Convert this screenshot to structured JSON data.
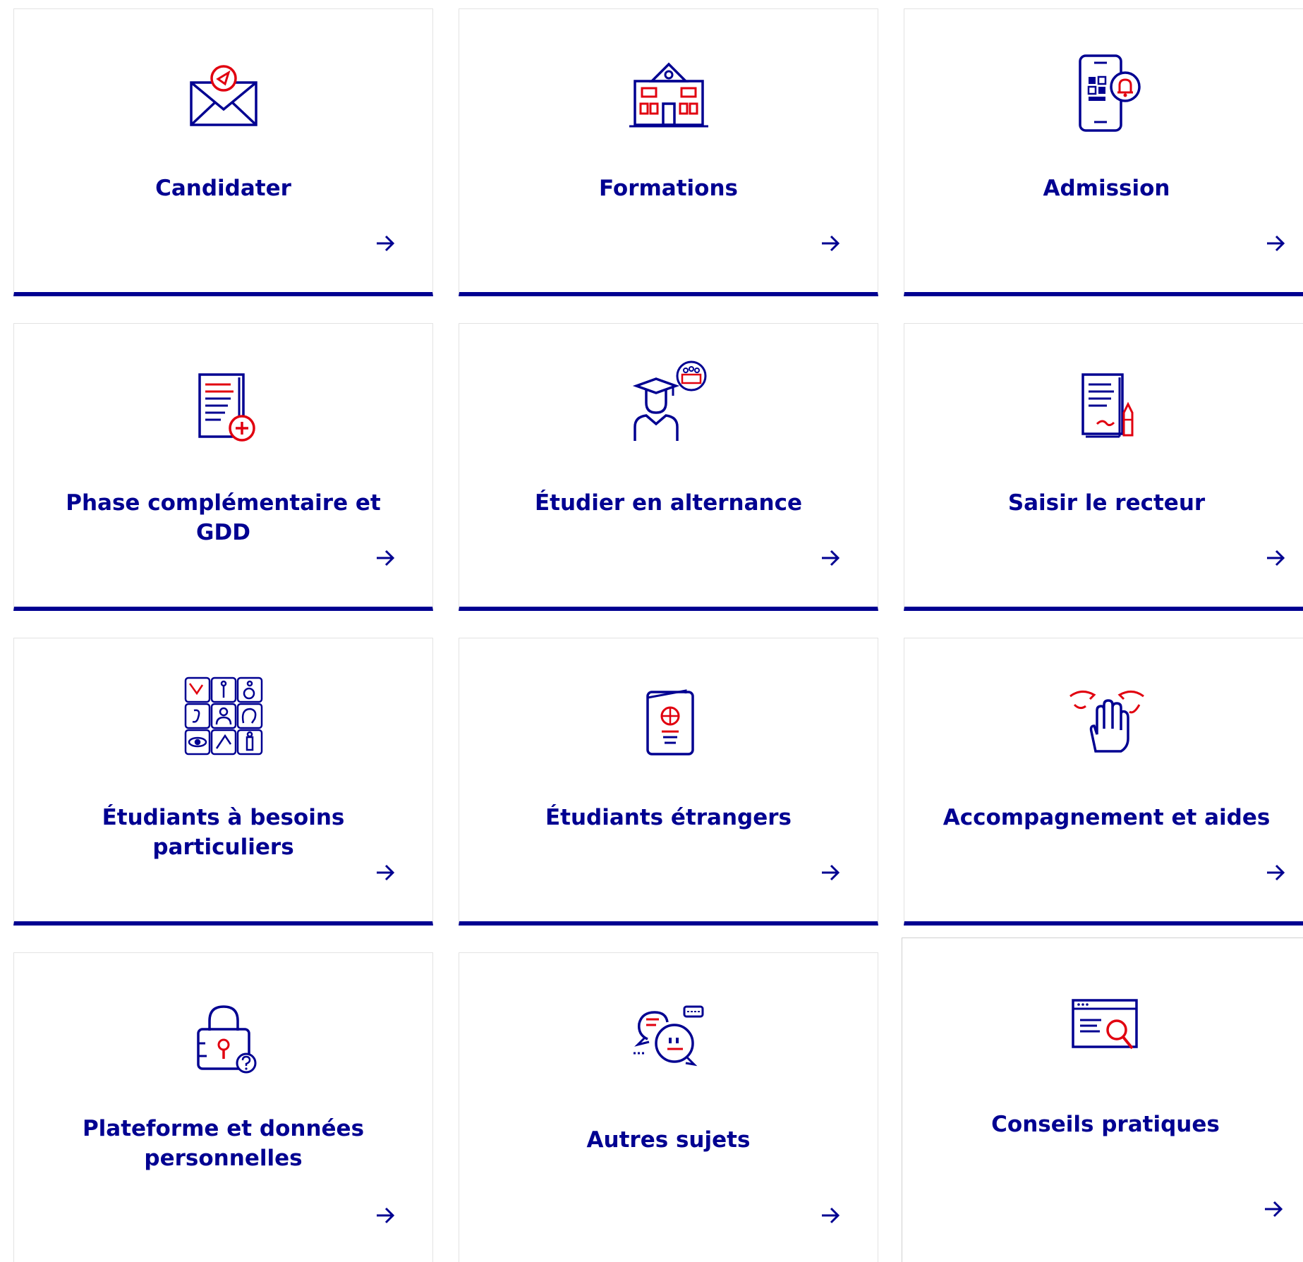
{
  "colors": {
    "primary": "#000091",
    "accent": "#e1000f",
    "border": "#e3e3e3",
    "background": "#ffffff"
  },
  "tiles": [
    {
      "title": "Candidater",
      "icon": "envelope-icon"
    },
    {
      "title": "Formations",
      "icon": "school-building-icon"
    },
    {
      "title": "Admission",
      "icon": "phone-notification-icon"
    },
    {
      "title": "Phase complémentaire et GDD",
      "icon": "document-add-icon"
    },
    {
      "title": "Étudier en alternance",
      "icon": "graduate-icon"
    },
    {
      "title": "Saisir le recteur",
      "icon": "document-pen-icon"
    },
    {
      "title": "Étudiants à besoins particuliers",
      "icon": "accessibility-grid-icon"
    },
    {
      "title": "Étudiants étrangers",
      "icon": "passport-icon"
    },
    {
      "title": "Accompagnement et aides",
      "icon": "helping-hands-icon"
    },
    {
      "title": "Plateforme et données personnelles",
      "icon": "padlock-icon"
    },
    {
      "title": "Autres sujets",
      "icon": "chat-bubbles-icon"
    },
    {
      "title": "Conseils pratiques",
      "icon": "browser-search-icon"
    }
  ]
}
